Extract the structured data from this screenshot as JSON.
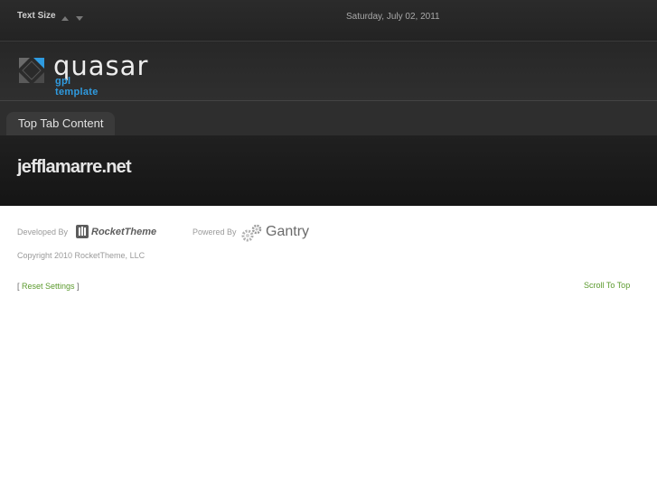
{
  "topbar": {
    "text_size_label": "Text Size",
    "date": "Saturday, July 02, 2011"
  },
  "header": {
    "logo_word": "quasar",
    "logo_sub": "gpl template"
  },
  "tabs": [
    {
      "label": "Top Tab Content"
    }
  ],
  "showcase": {
    "site_title": "jefflamarre.net"
  },
  "footer": {
    "developed_by": "Developed By",
    "rockettheme": "RocketTheme",
    "powered_by": "Powered By",
    "gantry": "Gantry",
    "copyright": "Copyright 2010 RocketTheme, LLC",
    "reset_open": "[ ",
    "reset_label": "Reset Settings",
    "reset_close": " ]",
    "scroll_to_top": "Scroll To Top"
  },
  "colors": {
    "accent_blue": "#2f9be0",
    "link_green": "#5b9a2d"
  }
}
